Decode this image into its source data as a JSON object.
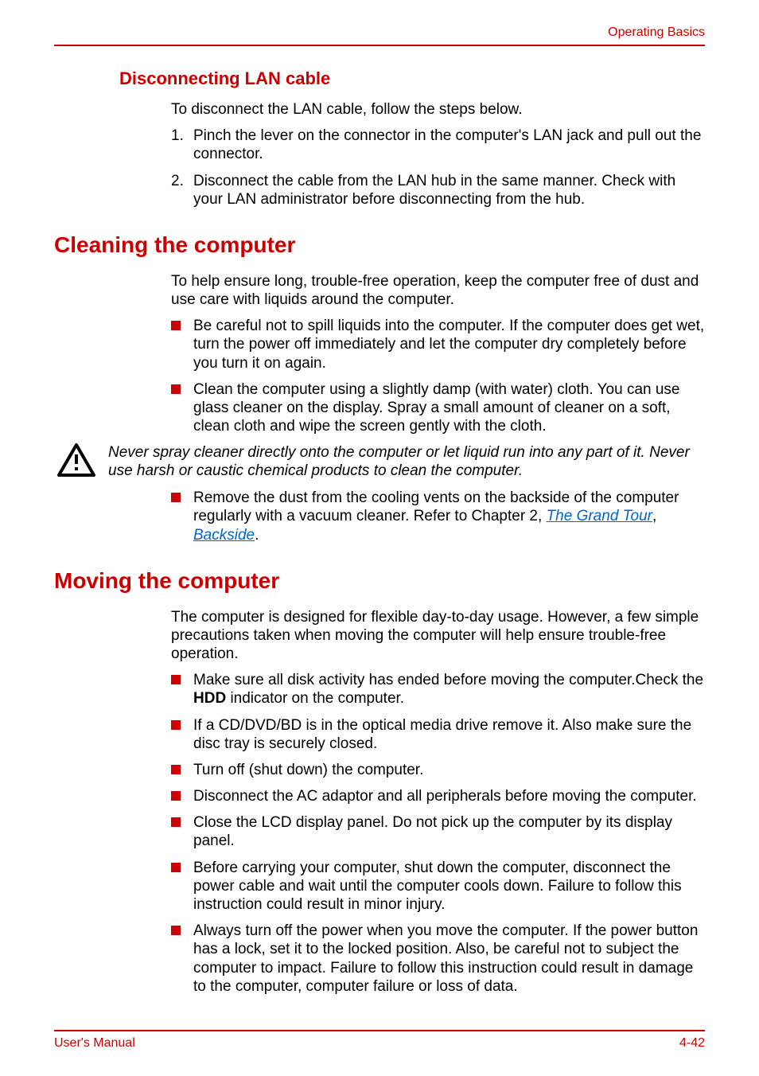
{
  "header": {
    "label": "Operating Basics"
  },
  "section1": {
    "title": "Disconnecting LAN cable",
    "intro": "To disconnect the LAN cable, follow the steps below.",
    "steps": [
      {
        "num": "1.",
        "text": "Pinch the lever on the connector in the computer's LAN jack and pull out the connector."
      },
      {
        "num": "2.",
        "text": "Disconnect the cable from the LAN hub in the same manner. Check with your LAN administrator before disconnecting from the hub."
      }
    ]
  },
  "section2": {
    "title": "Cleaning the computer",
    "intro": "To help ensure long, trouble-free operation, keep the computer free of dust and use care with liquids around the computer.",
    "bullets1": [
      "Be careful not to spill liquids into the computer. If the computer does get wet, turn the power off immediately and let the computer dry completely before you turn it on again.",
      "Clean the computer using a slightly damp (with water) cloth. You can use glass cleaner on the display. Spray a small amount of cleaner on a soft, clean cloth and wipe the screen gently with the cloth."
    ],
    "caution": "Never spray cleaner directly onto the computer or let liquid run into any part of it. Never use harsh or caustic chemical products to clean the computer.",
    "bullet3_pre": "Remove the dust from the cooling vents on the backside of the computer regularly with a vacuum cleaner. Refer to Chapter 2, ",
    "bullet3_link1": "The Grand Tour",
    "bullet3_sep": ", ",
    "bullet3_link2": "Backside",
    "bullet3_post": "."
  },
  "section3": {
    "title": "Moving the computer",
    "intro": "The computer is designed for flexible day-to-day usage. However, a few simple precautions taken when moving the computer will help ensure trouble-free operation.",
    "bullet1_pre": "Make sure all disk activity has ended before moving the computer.Check the ",
    "bullet1_bold": "HDD",
    "bullet1_post": " indicator on the computer.",
    "bullets_rest": [
      "If a CD/DVD/BD is in the optical media drive remove it. Also make sure the disc tray is securely closed.",
      "Turn off (shut down) the computer.",
      "Disconnect the AC adaptor and all peripherals before moving the computer.",
      "Close the LCD display panel. Do not pick up the computer by its display panel.",
      "Before carrying your computer, shut down the computer, disconnect the power cable and wait until the computer cools down. Failure to follow this instruction could result in minor injury.",
      "Always turn off the power when you move the computer. If the power button has a lock, set it to the locked position. Also, be careful not to subject the computer to impact. Failure to follow this instruction could result in damage to the computer, computer failure or loss of data."
    ]
  },
  "footer": {
    "left": "User's Manual",
    "right": "4-42"
  }
}
